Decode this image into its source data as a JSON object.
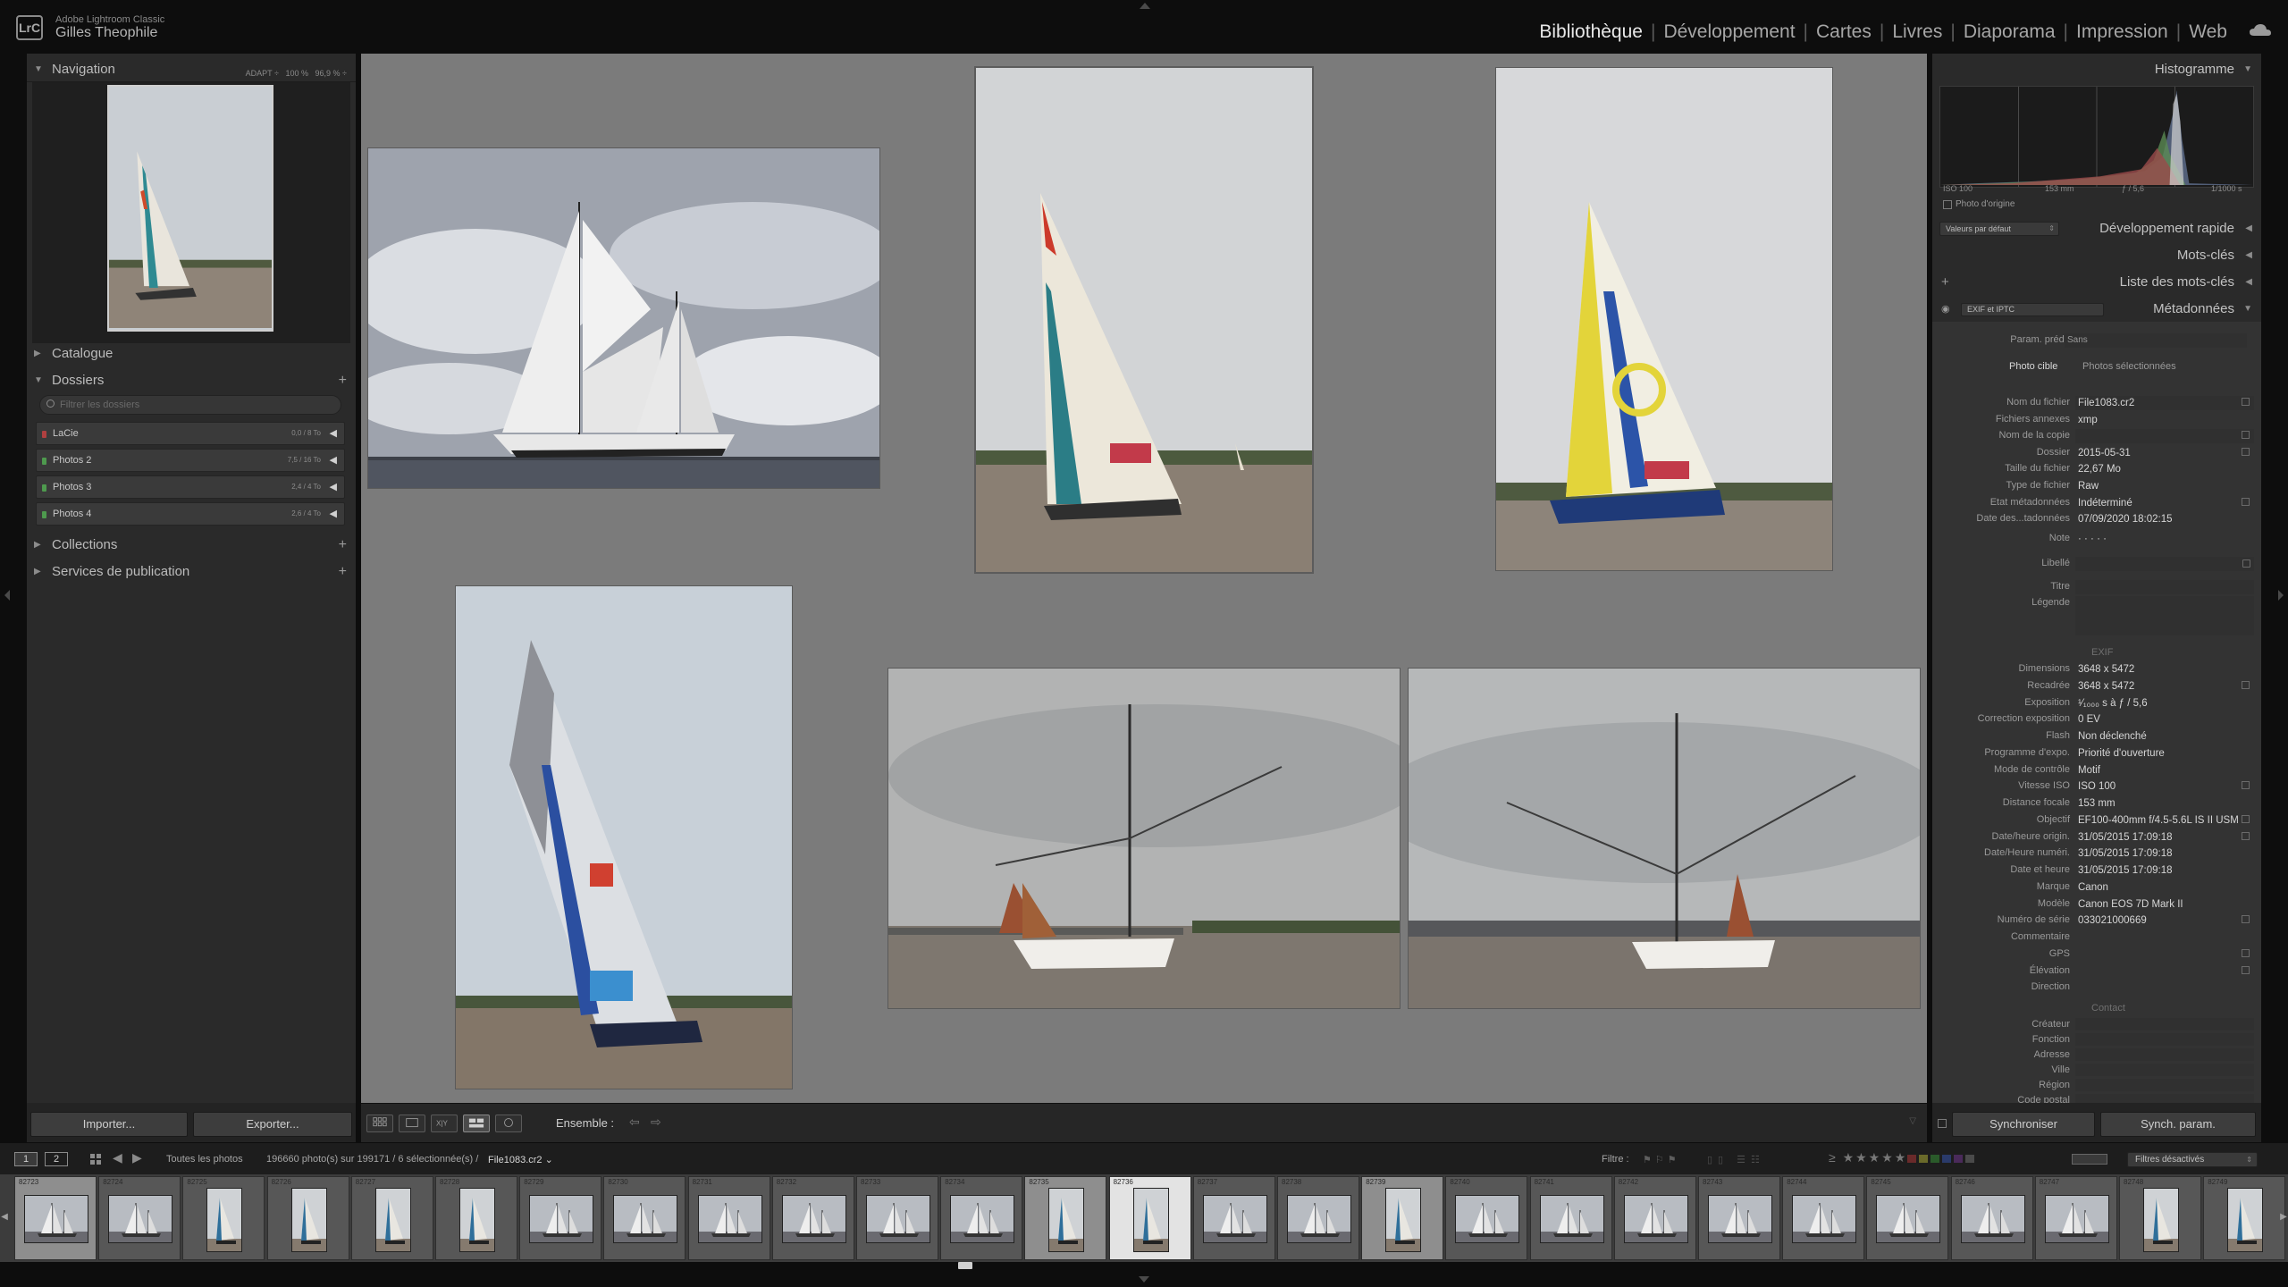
{
  "app": {
    "product": "Adobe Lightroom Classic",
    "user": "Gilles Theophile",
    "logo": "LrC"
  },
  "modules": [
    {
      "label": "Bibliothèque",
      "active": true
    },
    {
      "label": "Développement",
      "active": false
    },
    {
      "label": "Cartes",
      "active": false
    },
    {
      "label": "Livres",
      "active": false
    },
    {
      "label": "Diaporama",
      "active": false
    },
    {
      "label": "Impression",
      "active": false
    },
    {
      "label": "Web",
      "active": false
    }
  ],
  "left": {
    "navigation": {
      "title": "Navigation",
      "zoom1": "ADAPT ÷",
      "zoom2": "100 %",
      "zoom3": "96,9 % ÷"
    },
    "catalogue": "Catalogue",
    "dossiers": "Dossiers",
    "folder_search_placeholder": "Filtrer les dossiers",
    "folders": [
      {
        "name": "LaCie",
        "size": "0,0 / 8 To",
        "led": "red"
      },
      {
        "name": "Photos 2",
        "size": "7,5 / 16 To",
        "led": "green"
      },
      {
        "name": "Photos 3",
        "size": "2,4 / 4 To",
        "led": "green"
      },
      {
        "name": "Photos 4",
        "size": "2,6 / 4 To",
        "led": "green"
      }
    ],
    "collections": "Collections",
    "services": "Services de publication",
    "import_btn": "Importer...",
    "export_btn": "Exporter..."
  },
  "toolbar": {
    "ensemble": "Ensemble :"
  },
  "right": {
    "histogram": "Histogramme",
    "hist_info": [
      "ISO 100",
      "153 mm",
      "ƒ / 5,6",
      "1/1000 s"
    ],
    "original_photo": "Photo d'origine",
    "quick_dev": "Développement rapide",
    "preset_value": "Valeurs par défaut",
    "keywords": "Mots-clés",
    "keyword_list": "Liste des mots-clés",
    "metadata": "Métadonnées",
    "meta_view": "EXIF et IPTC",
    "preset_label": "Param. prédéf.",
    "preset_none": "Sans",
    "tab_target": "Photo cible",
    "tab_selected": "Photos sélectionnées",
    "rows": [
      {
        "label": "Nom du fichier",
        "value": "File1083.cr2",
        "box": true,
        "edit": true
      },
      {
        "label": "Fichiers annexes",
        "value": "xmp",
        "box": false,
        "edit": false
      },
      {
        "label": "Nom de la copie",
        "value": "",
        "box": true,
        "edit": true
      },
      {
        "label": "Dossier",
        "value": "2015-05-31",
        "box": false,
        "edit": true
      },
      {
        "label": "Taille du fichier",
        "value": "22,67 Mo",
        "box": false,
        "edit": false
      },
      {
        "label": "Type de fichier",
        "value": "Raw",
        "box": false,
        "edit": false
      },
      {
        "label": "Etat métadonnées",
        "value": "Indéterminé",
        "box": false,
        "edit": true
      },
      {
        "label": "Date des...tadonnées",
        "value": "07/09/2020 18:02:15",
        "box": false,
        "edit": false
      }
    ],
    "note_label": "Note",
    "note_value": "· · · · ·",
    "libelle": "Libellé",
    "titre": "Titre",
    "legende": "Légende",
    "exif_title": "EXIF",
    "exif": [
      {
        "label": "Dimensions",
        "value": "3648 x 5472",
        "edit": false
      },
      {
        "label": "Recadrée",
        "value": "3648 x 5472",
        "edit": true
      },
      {
        "label": "Exposition",
        "value": "¹⁄₁₀₀₀ s à ƒ / 5,6",
        "edit": false
      },
      {
        "label": "Correction exposition",
        "value": "0 EV",
        "edit": false
      },
      {
        "label": "Flash",
        "value": "Non déclenché",
        "edit": false
      },
      {
        "label": "Programme d'expo.",
        "value": "Priorité d'ouverture",
        "edit": false
      },
      {
        "label": "Mode de contrôle",
        "value": "Motif",
        "edit": false
      },
      {
        "label": "Vitesse ISO",
        "value": "ISO 100",
        "edit": true
      },
      {
        "label": "Distance focale",
        "value": "153 mm",
        "edit": false
      },
      {
        "label": "Objectif",
        "value": "EF100-400mm f/4.5-5.6L IS II USM",
        "edit": true
      },
      {
        "label": "Date/heure origin.",
        "value": "31/05/2015 17:09:18",
        "edit": true
      },
      {
        "label": "Date/Heure numéri.",
        "value": "31/05/2015 17:09:18",
        "edit": false
      },
      {
        "label": "Date et heure",
        "value": "31/05/2015 17:09:18",
        "edit": false
      },
      {
        "label": "Marque",
        "value": "Canon",
        "edit": false
      },
      {
        "label": "Modèle",
        "value": "Canon EOS 7D Mark II",
        "edit": false
      },
      {
        "label": "Numéro de série",
        "value": "033021000669",
        "edit": true
      },
      {
        "label": "Commentaire",
        "value": "",
        "edit": false
      },
      {
        "label": "GPS",
        "value": "",
        "edit": true
      },
      {
        "label": "Élévation",
        "value": "",
        "edit": true
      },
      {
        "label": "Direction",
        "value": "",
        "edit": false
      }
    ],
    "contact_title": "Contact",
    "contact": [
      "Créateur",
      "Fonction",
      "Adresse",
      "Ville",
      "Région",
      "Code postal"
    ],
    "sync_btn": "Synchroniser",
    "sync_param_btn": "Synch. param."
  },
  "filmbar": {
    "page1": "1",
    "page2": "2",
    "source": "Toutes les photos",
    "count": "196660 photo(s) sur 199171 / 6 sélectionnée(s) /",
    "file": "File1083.cr2 ⌄",
    "filter_label": "Filtre :",
    "filter_value": "Filtres désactivés"
  },
  "filmstrip": [
    {
      "num": "82723",
      "kind": "tallship",
      "state": "sel"
    },
    {
      "num": "82724",
      "kind": "tallship",
      "state": ""
    },
    {
      "num": "82725",
      "kind": "yacht",
      "state": ""
    },
    {
      "num": "82726",
      "kind": "yacht",
      "state": ""
    },
    {
      "num": "82727",
      "kind": "yacht",
      "state": ""
    },
    {
      "num": "82728",
      "kind": "yacht",
      "state": ""
    },
    {
      "num": "82729",
      "kind": "tallship",
      "state": ""
    },
    {
      "num": "82730",
      "kind": "tallship",
      "state": ""
    },
    {
      "num": "82731",
      "kind": "tallship",
      "state": ""
    },
    {
      "num": "82732",
      "kind": "tallship",
      "state": ""
    },
    {
      "num": "82733",
      "kind": "tallship",
      "state": ""
    },
    {
      "num": "82734",
      "kind": "tallship",
      "state": ""
    },
    {
      "num": "82735",
      "kind": "yacht",
      "state": "sel"
    },
    {
      "num": "82736",
      "kind": "yacht",
      "state": "active"
    },
    {
      "num": "82737",
      "kind": "tallship",
      "state": ""
    },
    {
      "num": "82738",
      "kind": "tallship",
      "state": ""
    },
    {
      "num": "82739",
      "kind": "yacht",
      "state": "sel"
    },
    {
      "num": "82740",
      "kind": "tallship",
      "state": ""
    },
    {
      "num": "82741",
      "kind": "tallship",
      "state": ""
    },
    {
      "num": "82742",
      "kind": "tallship",
      "state": ""
    },
    {
      "num": "82743",
      "kind": "tallship",
      "state": ""
    },
    {
      "num": "82744",
      "kind": "tallship",
      "state": ""
    },
    {
      "num": "82745",
      "kind": "tallship",
      "state": ""
    },
    {
      "num": "82746",
      "kind": "tallship",
      "state": ""
    },
    {
      "num": "82747",
      "kind": "tallship",
      "state": ""
    },
    {
      "num": "82748",
      "kind": "yacht",
      "state": ""
    },
    {
      "num": "82749",
      "kind": "yacht",
      "state": ""
    }
  ]
}
